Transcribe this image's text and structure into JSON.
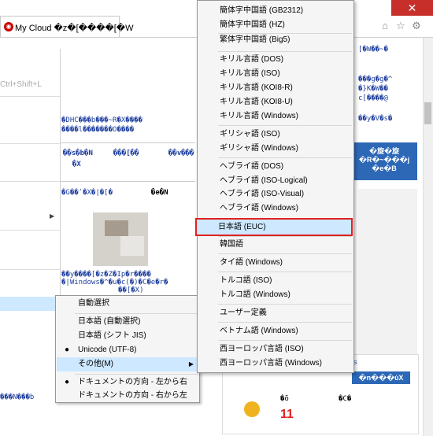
{
  "browser": {
    "tab_title": "My Cloud �z�[����[�W",
    "tab_close": "×",
    "close_window": "✕",
    "toolbar_icons": [
      "home-icon",
      "star-icon",
      "gear-icon"
    ]
  },
  "background_page": {
    "left_menu_shortcut": "Ctrl+Shift+L",
    "garbled_lines": [
      "�DHC���b���~R�X����",
      "����l�������O����",
      "��s�b�N",
      "�X",
      "���[��",
      "��v���",
      "�G��ʹ�X�|�[�",
      "�e�N",
      "��y����[�z�Z�Ip�r����",
      "�|Windows�^�u�c(�)�C�e�r�",
      "��[�X)",
      "���N���b",
      "[�W��~�",
      "���g�g�^",
      "�}K�W��",
      "c[����@",
      "��y�V�s�",
      "�n���ύX",
      "�õ",
      "�C�",
      "11"
    ],
    "right_nav_button": [
      "�旋�旋",
      "�R�~���j",
      "�e�B"
    ]
  },
  "submenu": {
    "items": [
      {
        "label": "自動選択",
        "checked": false,
        "has_arrow": false,
        "highlight": false
      },
      {
        "label": "日本語 (自動選択)",
        "checked": false,
        "has_arrow": false,
        "highlight": false
      },
      {
        "label": "日本語 (シフト JIS)",
        "checked": false,
        "has_arrow": false,
        "highlight": false
      },
      {
        "label": "Unicode (UTF-8)",
        "checked": true,
        "has_arrow": false,
        "highlight": false
      },
      {
        "label": "その他(M)",
        "checked": false,
        "has_arrow": true,
        "highlight": true
      },
      {
        "label": "ドキュメントの方向 - 左から右",
        "checked": true,
        "has_arrow": false,
        "highlight": false
      },
      {
        "label": "ドキュメントの方向 - 右から左",
        "checked": false,
        "has_arrow": false,
        "highlight": false
      }
    ]
  },
  "language_menu": {
    "items": [
      "簡体字中国語 (GB2312)",
      "簡体字中国語 (HZ)",
      "繁体字中国語 (Big5)",
      "キリル言語 (DOS)",
      "キリル言語 (ISO)",
      "キリル言語 (KOI8-R)",
      "キリル言語 (KOI8-U)",
      "キリル言語 (Windows)",
      "ギリシャ語 (ISO)",
      "ギリシャ語 (Windows)",
      "ヘブライ語 (DOS)",
      "ヘブライ語 (ISO-Logical)",
      "ヘブライ語 (ISO-Visual)",
      "ヘブライ語 (Windows)",
      "日本語 (EUC)",
      "韓国語",
      "タイ語 (Windows)",
      "トルコ語 (ISO)",
      "トルコ語 (Windows)",
      "ユーザー定義",
      "ベトナム語 (Windows)",
      "西ヨーロッパ言語 (ISO)",
      "西ヨーロッパ言語 (Windows)"
    ],
    "selected": "日本語 (EUC)",
    "selected_color": "#e02020"
  }
}
